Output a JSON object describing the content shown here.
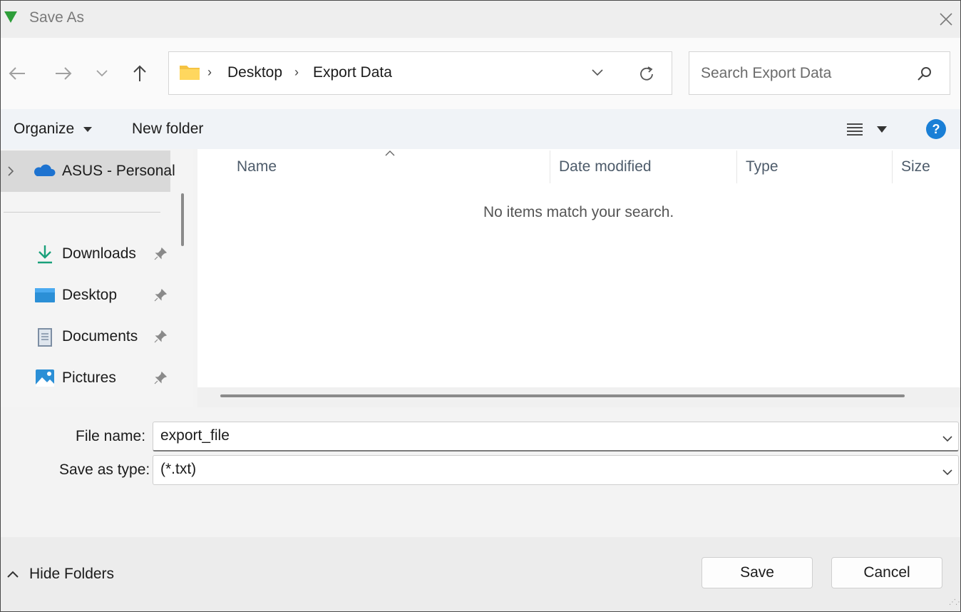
{
  "window": {
    "title": "Save As"
  },
  "nav": {
    "breadcrumb": [
      "Desktop",
      "Export Data"
    ],
    "search_placeholder": "Search Export Data"
  },
  "commands": {
    "organize": "Organize",
    "new_folder": "New folder"
  },
  "sidebar": {
    "top_item": "ASUS - Personal",
    "items": [
      {
        "label": "Downloads",
        "icon": "download-icon"
      },
      {
        "label": "Desktop",
        "icon": "desktop-icon"
      },
      {
        "label": "Documents",
        "icon": "document-icon"
      },
      {
        "label": "Pictures",
        "icon": "pictures-icon"
      }
    ]
  },
  "filelist": {
    "columns": [
      "Name",
      "Date modified",
      "Type",
      "Size"
    ],
    "empty_message": "No items match your search."
  },
  "form": {
    "file_name_label": "File name:",
    "file_name_value": "export_file",
    "type_label": "Save as type:",
    "type_value": "(*.txt)"
  },
  "footer": {
    "hide_folders": "Hide Folders",
    "save": "Save",
    "cancel": "Cancel"
  },
  "colors": {
    "accent": "#0067c0",
    "folder": "#f5c342",
    "onedrive": "#1e73d0",
    "app_icon": "#2e9e3a"
  }
}
